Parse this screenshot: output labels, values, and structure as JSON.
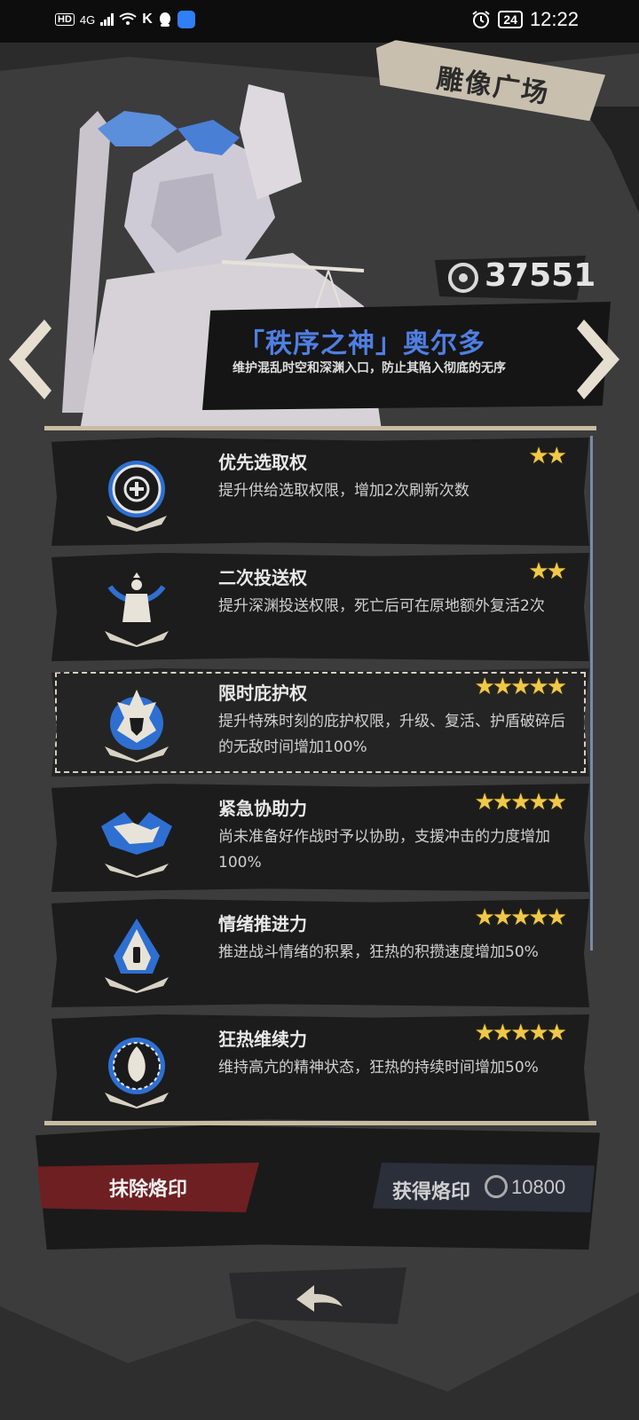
{
  "status_bar": {
    "left_chip": "HD",
    "network": "4G",
    "app_letter": "K",
    "battery": "24",
    "time": "12:22"
  },
  "header": {
    "title": "雕像广场"
  },
  "currency": {
    "amount": "37551",
    "icon": "coin-icon"
  },
  "deity": {
    "name": "「秩序之神」奥尔多",
    "description": "维护混乱时空和深渊入口，防止其陷入彻底的无序"
  },
  "skills": [
    {
      "name": "优先选取权",
      "description": "提升供给选取权限，增加2次刷新次数",
      "stars": 2,
      "stars_text": "★★",
      "icon": "plus-emblem-icon"
    },
    {
      "name": "二次投送权",
      "description": "提升深渊投送权限，死亡后可在原地额外复活2次",
      "stars": 2,
      "stars_text": "★★",
      "icon": "figure-emblem-icon"
    },
    {
      "name": "限时庇护权",
      "description": "提升特殊时刻的庇护权限，升级、复活、护盾破碎后的无敌时间增加100%",
      "stars": 5,
      "stars_text": "★★★★★",
      "icon": "shield-face-emblem-icon",
      "selected": true
    },
    {
      "name": "紧急协助力",
      "description": "尚未准备好作战时予以协助，支援冲击的力度增加100%",
      "stars": 5,
      "stars_text": "★★★★★",
      "icon": "handshake-emblem-icon"
    },
    {
      "name": "情绪推进力",
      "description": "推进战斗情绪的积累，狂热的积攒速度增加50%",
      "stars": 5,
      "stars_text": "★★★★★",
      "icon": "flame-emblem-icon"
    },
    {
      "name": "狂热维续力",
      "description": "维持高亢的精神状态，狂热的持续时间增加50%",
      "stars": 5,
      "stars_text": "★★★★★",
      "icon": "fire-ring-emblem-icon"
    }
  ],
  "actions": {
    "erase_label": "抹除烙印",
    "get_label": "获得烙印",
    "get_cost": "10800"
  },
  "colors": {
    "accent_blue": "#4f7fe3",
    "star_gold": "#f0c94a",
    "erase_red": "#6e1f22",
    "frame_beige": "#c9bca3"
  }
}
